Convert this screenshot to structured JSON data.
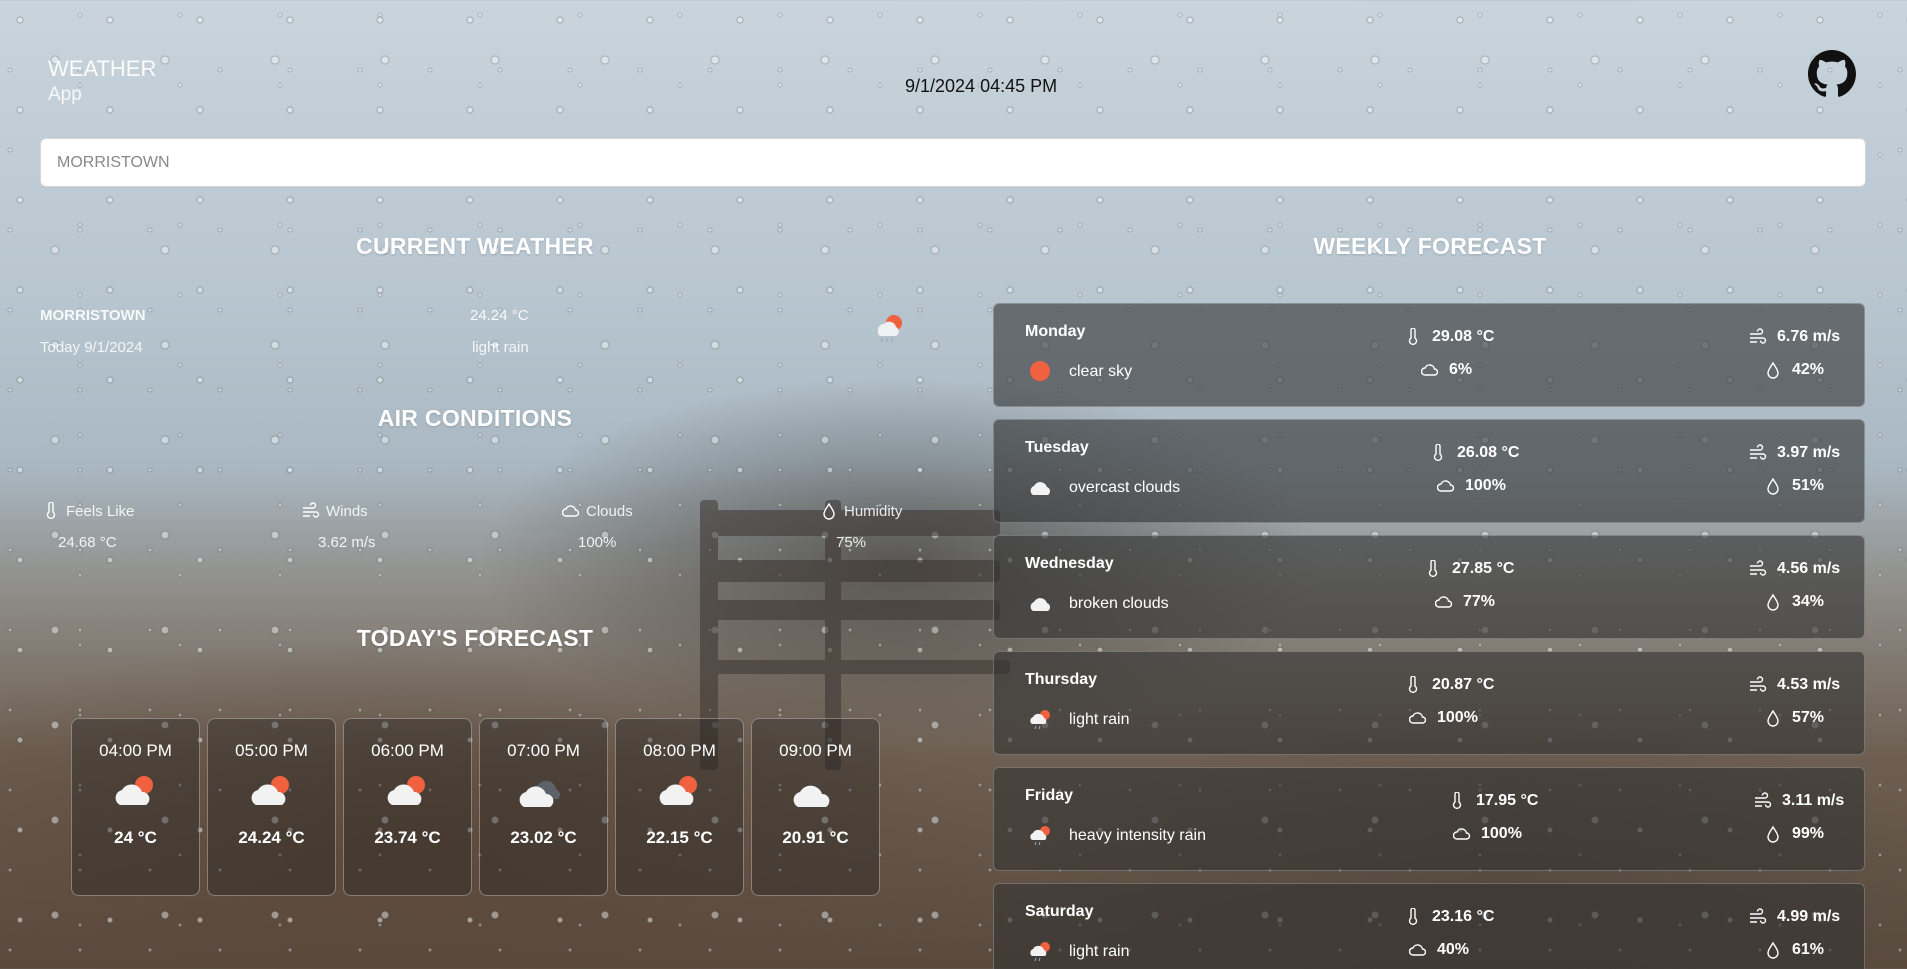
{
  "app": {
    "title_line1": "WEATHER",
    "title_line2": "App"
  },
  "header": {
    "datetime": "9/1/2024 04:45 PM"
  },
  "search": {
    "placeholder": "MORRISTOWN"
  },
  "current": {
    "section_title": "CURRENT WEATHER",
    "city": "MORRISTOWN",
    "date": "Today 9/1/2024",
    "temperature": "24.24 °C",
    "description": "light rain",
    "icon": "light-rain-icon"
  },
  "air": {
    "section_title": "AIR CONDITIONS",
    "items": [
      {
        "label": "Feels Like",
        "value": "24.68 °C",
        "icon": "thermometer-icon"
      },
      {
        "label": "Winds",
        "value": "3.62 m/s",
        "icon": "wind-icon"
      },
      {
        "label": "Clouds",
        "value": "100%",
        "icon": "cloud-icon"
      },
      {
        "label": "Humidity",
        "value": "75%",
        "icon": "humidity-icon"
      }
    ]
  },
  "today": {
    "section_title": "TODAY'S FORECAST",
    "hours": [
      {
        "time": "04:00 PM",
        "temp": "24 °C",
        "icon": "partly-cloudy-icon"
      },
      {
        "time": "05:00 PM",
        "temp": "24.24 °C",
        "icon": "partly-cloudy-icon"
      },
      {
        "time": "06:00 PM",
        "temp": "23.74 °C",
        "icon": "partly-cloudy-icon"
      },
      {
        "time": "07:00 PM",
        "temp": "23.02 °C",
        "icon": "dark-cloud-icon"
      },
      {
        "time": "08:00 PM",
        "temp": "22.15 °C",
        "icon": "partly-cloudy-icon"
      },
      {
        "time": "09:00 PM",
        "temp": "20.91 °C",
        "icon": "cloud-icon"
      }
    ]
  },
  "weekly": {
    "section_title": "WEEKLY FORECAST",
    "days": [
      {
        "day": "Monday",
        "desc": "clear sky",
        "temp": "29.08 °C",
        "clouds": "6%",
        "wind": "6.76 m/s",
        "humidity": "42%",
        "icon": "sun-icon"
      },
      {
        "day": "Tuesday",
        "desc": "overcast clouds",
        "temp": "26.08 °C",
        "clouds": "100%",
        "wind": "3.97 m/s",
        "humidity": "51%",
        "icon": "cloud-icon"
      },
      {
        "day": "Wednesday",
        "desc": "broken clouds",
        "temp": "27.85 °C",
        "clouds": "77%",
        "wind": "4.56 m/s",
        "humidity": "34%",
        "icon": "cloud-icon"
      },
      {
        "day": "Thursday",
        "desc": "light rain",
        "temp": "20.87 °C",
        "clouds": "100%",
        "wind": "4.53 m/s",
        "humidity": "57%",
        "icon": "rain-icon"
      },
      {
        "day": "Friday",
        "desc": "heavy intensity rain",
        "temp": "17.95 °C",
        "clouds": "100%",
        "wind": "3.11 m/s",
        "humidity": "99%",
        "icon": "rain-icon"
      },
      {
        "day": "Saturday",
        "desc": "light rain",
        "temp": "23.16 °C",
        "clouds": "40%",
        "wind": "4.99 m/s",
        "humidity": "61%",
        "icon": "rain-icon"
      }
    ]
  },
  "colors": {
    "sun": "#f0623f",
    "card_bg": "#333333",
    "text": "#ffffff",
    "datetime": "#111111"
  }
}
